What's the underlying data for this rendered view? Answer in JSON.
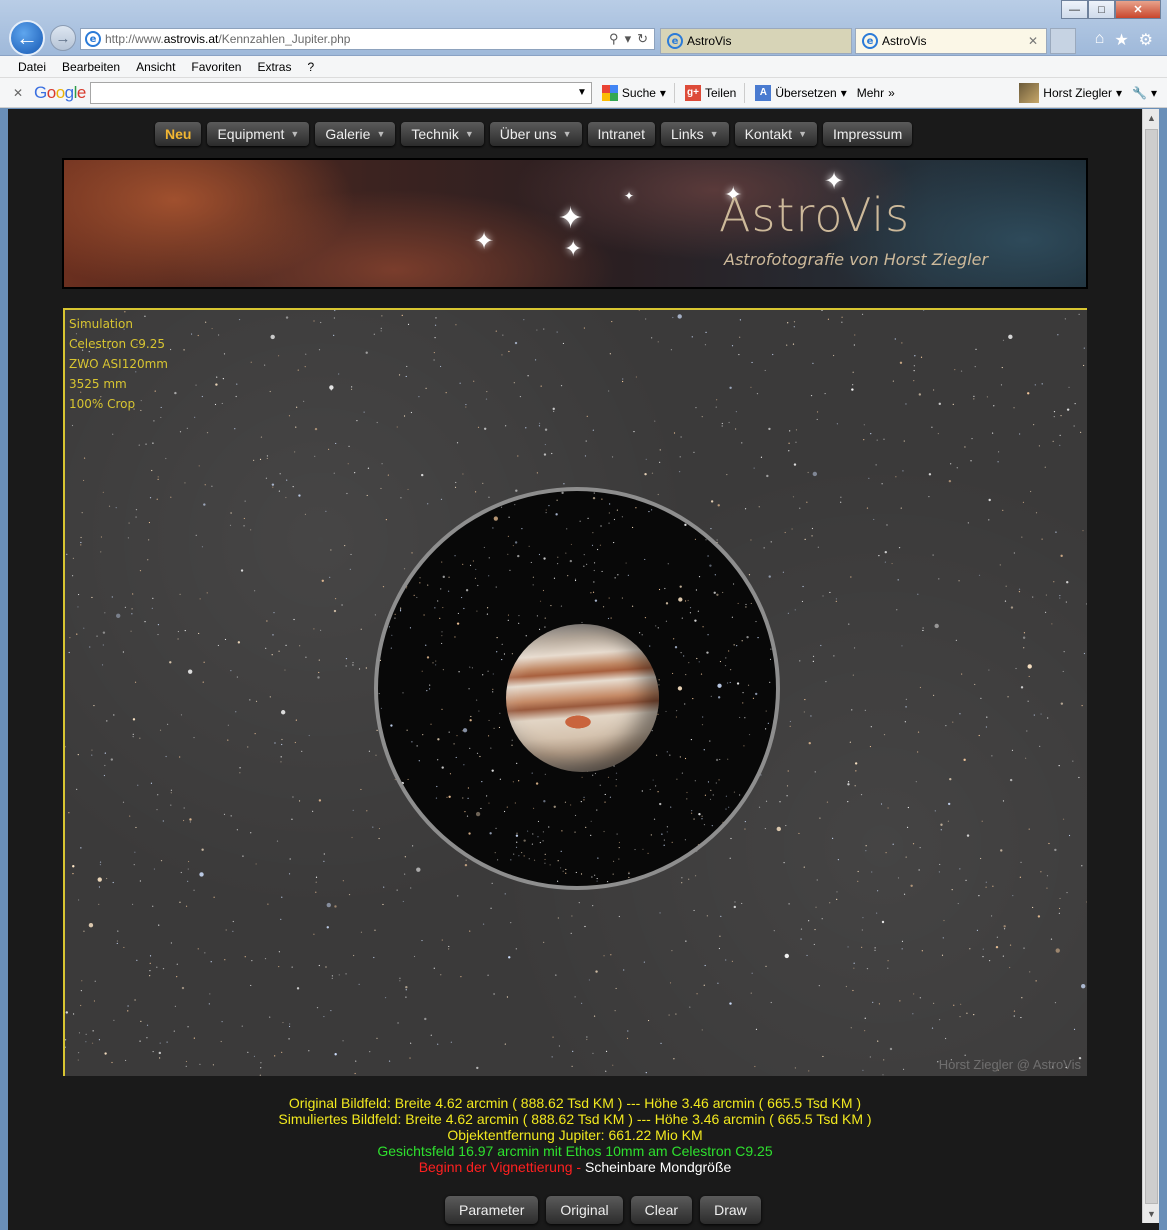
{
  "browser": {
    "url_prefix": "http://www.",
    "url_domain": "astrovis.at",
    "url_path": "/Kennzahlen_Jupiter.php",
    "tabs": [
      {
        "label": "AstroVis"
      },
      {
        "label": "AstroVis"
      }
    ],
    "menu": [
      "Datei",
      "Bearbeiten",
      "Ansicht",
      "Favoriten",
      "Extras",
      "?"
    ],
    "google_toolbar": {
      "search_label": "Suche",
      "share_label": "Teilen",
      "translate_label": "Übersetzen",
      "more_label": "Mehr",
      "user_label": "Horst Ziegler"
    }
  },
  "site": {
    "nav": [
      {
        "label": "Neu",
        "has_menu": false
      },
      {
        "label": "Equipment",
        "has_menu": true
      },
      {
        "label": "Galerie",
        "has_menu": true
      },
      {
        "label": "Technik",
        "has_menu": true
      },
      {
        "label": "Über uns",
        "has_menu": true
      },
      {
        "label": "Intranet",
        "has_menu": false
      },
      {
        "label": "Links",
        "has_menu": true
      },
      {
        "label": "Kontakt",
        "has_menu": true
      },
      {
        "label": "Impressum",
        "has_menu": false
      }
    ],
    "banner": {
      "title": "AstroVis",
      "subtitle": "Astrofotografie von Horst Ziegler"
    }
  },
  "simulation": {
    "info_lines": [
      "Simulation",
      "Celestron C9.25",
      "ZWO ASI120mm",
      "3525 mm",
      "100% Crop"
    ],
    "watermark": "Horst Ziegler @ AstroVis"
  },
  "stats": {
    "original": "Original Bildfeld: Breite 4.62 arcmin ( 888.62 Tsd KM ) --- Höhe 3.46 arcmin ( 665.5 Tsd KM )",
    "simulated": "Simuliertes Bildfeld: Breite 4.62 arcmin ( 888.62 Tsd KM ) --- Höhe 3.46 arcmin ( 665.5 Tsd KM )",
    "distance": "Objektentfernung Jupiter: 661.22 Mio KM",
    "fov": "Gesichtsfeld 16.97 arcmin mit Ethos 10mm am Celestron C9.25",
    "vignette": "Beginn der Vignettierung - ",
    "moon": "Scheinbare Mondgröße"
  },
  "actions": {
    "parameter": "Parameter",
    "original": "Original",
    "clear": "Clear",
    "draw": "Draw"
  },
  "colors": {
    "nav_active": "#f2b632",
    "frame_border": "#d8c531",
    "stat_yellow": "#f2e91f",
    "stat_green": "#2ee02e",
    "stat_red": "#ff2020"
  }
}
